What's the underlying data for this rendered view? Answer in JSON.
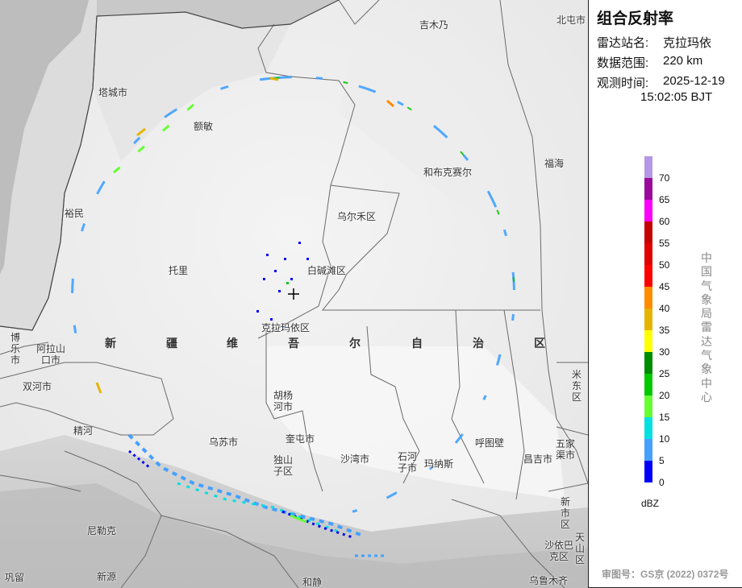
{
  "panel": {
    "title": "组合反射率",
    "station_label": "雷达站名:",
    "station_value": "克拉玛依",
    "range_label": "数据范围:",
    "range_value": "220 km",
    "time_label": "观测时间:",
    "time_date": "2025-12-19",
    "time_clock": "15:02:05 BJT",
    "unit": "dBZ",
    "organization": "中国气象局雷达气象中心",
    "review_number": "审图号：GS京 (2022) 0372号"
  },
  "legend": {
    "colors": [
      "#b497e6",
      "#9b0b9b",
      "#fb00fb",
      "#c50000",
      "#e10000",
      "#ff0000",
      "#ff8c00",
      "#e6b400",
      "#ffff00",
      "#008c00",
      "#00c800",
      "#66ff33",
      "#00e0e0",
      "#45a0ff",
      "#0000f6"
    ],
    "labels": [
      "70",
      "65",
      "60",
      "55",
      "50",
      "45",
      "40",
      "35",
      "30",
      "25",
      "20",
      "15",
      "10",
      "5",
      "0"
    ]
  },
  "map": {
    "place_labels": [
      {
        "name": "吉木乃",
        "key": "jimunai"
      },
      {
        "name": "北屯市",
        "key": "beitun"
      },
      {
        "name": "塔城市",
        "key": "tacheng"
      },
      {
        "name": "额敏",
        "key": "emin"
      },
      {
        "name": "和布克赛尔",
        "key": "hebukesaier"
      },
      {
        "name": "福海",
        "key": "fuhai"
      },
      {
        "name": "裕民",
        "key": "yumin"
      },
      {
        "name": "乌尔禾区",
        "key": "wuerhe"
      },
      {
        "name": "托里",
        "key": "tuoli"
      },
      {
        "name": "白碱滩区",
        "key": "baijiantan"
      },
      {
        "name": "克拉玛依区",
        "key": "kelamayi"
      },
      {
        "name": "双河市",
        "key": "shuanghe"
      },
      {
        "name": "胡杨河市",
        "key": "huyanghe",
        "vertical": true,
        "lines": [
          "胡杨",
          "河市"
        ]
      },
      {
        "name": "精河",
        "key": "jinghe"
      },
      {
        "name": "乌苏市",
        "key": "wusu"
      },
      {
        "name": "奎屯市",
        "key": "kuitun"
      },
      {
        "name": "独山子区",
        "key": "dushanzi",
        "lines": [
          "独山",
          "子区"
        ]
      },
      {
        "name": "沙湾市",
        "key": "shawan"
      },
      {
        "name": "石河子市",
        "key": "shihezi",
        "lines": [
          "石河",
          "子市"
        ]
      },
      {
        "name": "玛纳斯",
        "key": "manasi"
      },
      {
        "name": "呼图壁",
        "key": "hutubi"
      },
      {
        "name": "昌吉市",
        "key": "changji"
      },
      {
        "name": "尼勒克",
        "key": "nileke"
      },
      {
        "name": "新源",
        "key": "xinyuan"
      },
      {
        "name": "巩留",
        "key": "gongliu"
      },
      {
        "name": "和静",
        "key": "hejing"
      },
      {
        "name": "乌鲁木齐",
        "key": "wulumuqi"
      }
    ],
    "vertical_labels": [
      {
        "name": "博乐市",
        "key": "bole"
      },
      {
        "name": "阿拉山口市",
        "key": "alashankou",
        "lines": [
          "阿拉山",
          "口市"
        ]
      },
      {
        "name": "米东区",
        "key": "midong"
      },
      {
        "name": "五家渠市",
        "key": "wujiaqu",
        "lines": [
          "五家",
          "渠市"
        ]
      },
      {
        "name": "新市区",
        "key": "xinshi"
      },
      {
        "name": "沙依巴克区",
        "key": "shayibake",
        "lines": [
          "沙依巴",
          "克区"
        ]
      },
      {
        "name": "天山区",
        "key": "tianshan"
      }
    ],
    "region_name": [
      "新",
      "疆",
      "维",
      "吾",
      "尔",
      "自",
      "治",
      "区"
    ],
    "radar_marker": "+"
  }
}
